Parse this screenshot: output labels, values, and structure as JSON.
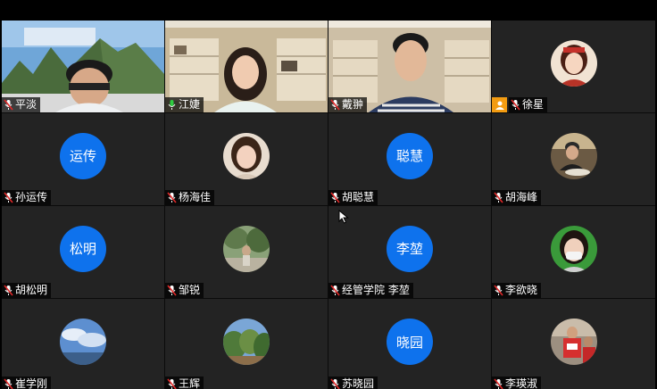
{
  "participants": [
    {
      "name": "平淡",
      "type": "video",
      "muted": true
    },
    {
      "name": "江婕",
      "type": "video",
      "muted": false,
      "speaking": true
    },
    {
      "name": "戴翀",
      "type": "video",
      "muted": true
    },
    {
      "name": "徐星",
      "type": "photo",
      "muted": true,
      "host": true
    },
    {
      "name": "孙运传",
      "type": "initials",
      "initials": "运传",
      "muted": true
    },
    {
      "name": "杨海佳",
      "type": "photo",
      "muted": true
    },
    {
      "name": "胡聪慧",
      "type": "initials",
      "initials": "聪慧",
      "muted": true
    },
    {
      "name": "胡海峰",
      "type": "photo",
      "muted": true
    },
    {
      "name": "胡松明",
      "type": "initials",
      "initials": "松明",
      "muted": true
    },
    {
      "name": "邹锐",
      "type": "photo",
      "muted": true
    },
    {
      "name": "经管学院 李堃",
      "type": "initials",
      "initials": "李堃",
      "muted": true
    },
    {
      "name": "李欲晓",
      "type": "photo",
      "muted": true
    },
    {
      "name": "崔学刚",
      "type": "photo",
      "muted": true
    },
    {
      "name": "王辉",
      "type": "photo",
      "muted": true
    },
    {
      "name": "苏晓园",
      "type": "initials",
      "initials": "晓园",
      "muted": true
    },
    {
      "name": "李瑛淑",
      "type": "photo",
      "muted": true
    }
  ],
  "colors": {
    "tile_bg": "#232323",
    "avatar_blue": "#0e72ed",
    "speaking_border": "#2ecc40",
    "host_badge": "#f39c12"
  },
  "icons": {
    "muted": "mic-muted-icon",
    "unmuted": "mic-on-icon",
    "host": "host-user-icon",
    "cursor": "mouse-pointer-icon"
  }
}
